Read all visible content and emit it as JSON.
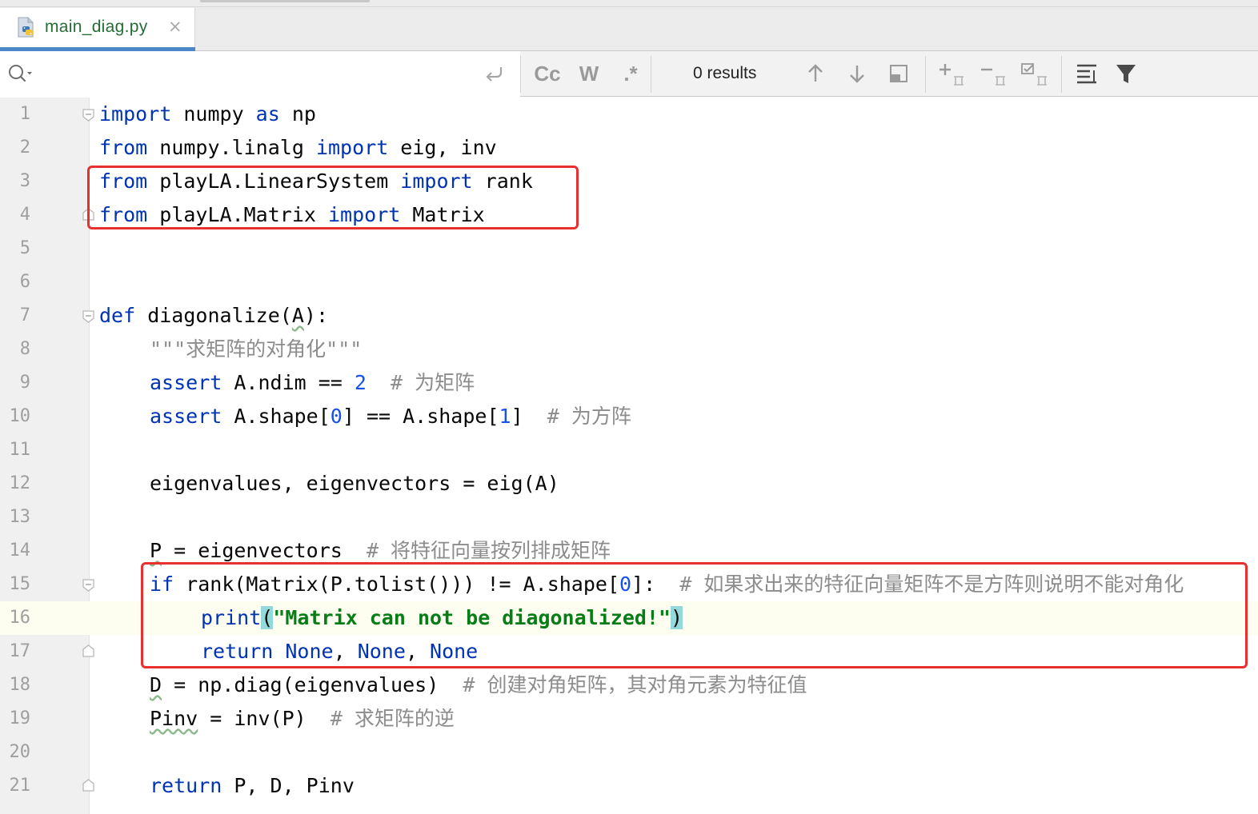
{
  "tab": {
    "title": "main_diag.py",
    "close_glyph": "×",
    "icon": "python-file-icon"
  },
  "find": {
    "query": "",
    "placeholder": "",
    "match_case_label": "Cc",
    "words_label": "W",
    "regex_label": ".*",
    "results_label": "0 results"
  },
  "editor": {
    "lines": [
      {
        "n": "1"
      },
      {
        "n": "2"
      },
      {
        "n": "3"
      },
      {
        "n": "4"
      },
      {
        "n": "5"
      },
      {
        "n": "6"
      },
      {
        "n": "7"
      },
      {
        "n": "8"
      },
      {
        "n": "9"
      },
      {
        "n": "10"
      },
      {
        "n": "11"
      },
      {
        "n": "12"
      },
      {
        "n": "13"
      },
      {
        "n": "14"
      },
      {
        "n": "15"
      },
      {
        "n": "16"
      },
      {
        "n": "17"
      },
      {
        "n": "18"
      },
      {
        "n": "19"
      },
      {
        "n": "20"
      },
      {
        "n": "21"
      }
    ],
    "current_line": 16,
    "code": {
      "l1": {
        "k1": "import",
        "t1": " numpy ",
        "k2": "as",
        "t2": " np"
      },
      "l2": {
        "k1": "from",
        "t1": " numpy.linalg ",
        "k2": "import",
        "t2": " eig, inv"
      },
      "l3": {
        "k1": "from",
        "t1": " playLA.LinearSystem ",
        "k2": "import",
        "t2": " rank"
      },
      "l4": {
        "k1": "from",
        "t1": " playLA.Matrix ",
        "k2": "import",
        "t2": " Matrix"
      },
      "l7": {
        "k1": "def",
        "t1": " diagonalize(",
        "t2": "A",
        "t3": "):"
      },
      "l8": {
        "doc": "\"\"\"求矩阵的对角化\"\"\""
      },
      "l9": {
        "k1": "assert",
        "t1": " A.ndim == ",
        "n1": "2",
        "cm": "  # 为矩阵"
      },
      "l10": {
        "k1": "assert",
        "t1": " A.shape[",
        "n1": "0",
        "t2": "] == A.shape[",
        "n2": "1",
        "t3": "]",
        "cm": "  # 为方阵"
      },
      "l12": {
        "t1": "eigenvalues, eigenvectors = eig(A)"
      },
      "l14": {
        "t1": "P",
        "t2": " = eigenvectors",
        "cm": "  # 将特征向量按列排成矩阵"
      },
      "l15": {
        "k1": "if",
        "t1": " rank(Matrix(P.tolist())) != A.shape[",
        "n1": "0",
        "t2": "]:",
        "cm": "  # 如果求出来的特征向量矩阵不是方阵则说明不能对角化"
      },
      "l16": {
        "k1": "print",
        "p1": "(",
        "s1": "\"Matrix can not be diagonalized!\"",
        "p2": ")"
      },
      "l17": {
        "k1": "return",
        "t1": " ",
        "k2": "None",
        "t2": ", ",
        "k3": "None",
        "t3": ", ",
        "k4": "None"
      },
      "l18": {
        "t1": "D",
        "t2": " = np.diag(eigenvalues)",
        "cm": "  # 创建对角矩阵，其对角元素为特征值"
      },
      "l19": {
        "t1": "Pinv",
        "t2": " = inv(P)",
        "cm": "  # 求矩阵的逆"
      },
      "l21": {
        "k1": "return",
        "t1": " P, D, Pinv"
      }
    }
  },
  "colors": {
    "keyword": "#0033b3",
    "number": "#1750eb",
    "string": "#067d17",
    "comment": "#8c8c8c",
    "highlight_box": "#e8302e",
    "tab_underline": "#4a88c7",
    "tab_title": "#246d35"
  },
  "icons": [
    "python-file-icon",
    "search-icon",
    "newline-icon",
    "arrow-up-icon",
    "arrow-down-icon",
    "open-in-window-icon",
    "add-selection-icon",
    "remove-selection-icon",
    "select-all-icon",
    "filter-settings-icon",
    "funnel-icon",
    "fold-icon"
  ]
}
